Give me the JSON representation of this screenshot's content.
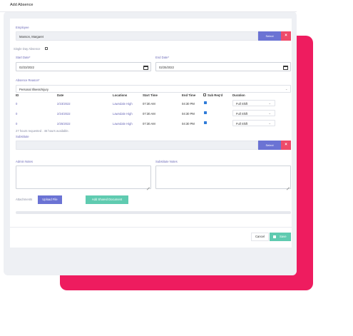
{
  "dialog": {
    "title": "Add Absence"
  },
  "employee": {
    "label": "Employee",
    "value": "Manson, Margaret",
    "select_label": "Select",
    "clear_icon": "close-icon"
  },
  "single_day": {
    "label": "Single Day Absence",
    "checked": false
  },
  "start_date": {
    "label": "Start Date*",
    "value": "02/23/2022"
  },
  "end_date": {
    "label": "End Date*",
    "value": "02/25/2022"
  },
  "reason": {
    "label": "Absence Reason*",
    "value": "Personal Illness/Injury"
  },
  "table": {
    "headers": {
      "id": "ID",
      "date": "Date",
      "locations": "Locations",
      "start_time": "Start Time",
      "end_time": "End Time",
      "sub_req": "Sub Req'd",
      "duration": "Duration"
    },
    "rows": [
      {
        "id": "0",
        "date": "2/23/2022",
        "location": "Lawndale High",
        "start": "07:30 AM",
        "end": "04:30 PM",
        "sub_req": true,
        "duration": "Full Shift"
      },
      {
        "id": "0",
        "date": "2/24/2022",
        "location": "Lawndale High",
        "start": "07:30 AM",
        "end": "04:30 PM",
        "sub_req": true,
        "duration": "Full Shift"
      },
      {
        "id": "0",
        "date": "2/25/2022",
        "location": "Lawndale High",
        "start": "07:30 AM",
        "end": "04:30 PM",
        "sub_req": true,
        "duration": "Full Shift"
      }
    ],
    "summary": "27 hours requested . 46 hours available."
  },
  "substitute": {
    "label": "Substitute",
    "value": "",
    "select_label": "Select",
    "clear_icon": "close-icon"
  },
  "admin_notes": {
    "label": "Admin Notes",
    "value": ""
  },
  "substitute_notes": {
    "label": "Substitute Notes",
    "value": ""
  },
  "attachments": {
    "label": "Attachments",
    "upload_label": "Upload File",
    "shared_label": "Add Shared Document"
  },
  "footer": {
    "cancel_label": "Cancel",
    "save_label": "Save",
    "save_icon": "save-icon"
  },
  "colors": {
    "primary": "#6b73d4",
    "danger": "#ee4b6a",
    "success": "#5fcbb0",
    "accent_pink": "#ee1c5f",
    "checkbox": "#2f7bd8"
  }
}
